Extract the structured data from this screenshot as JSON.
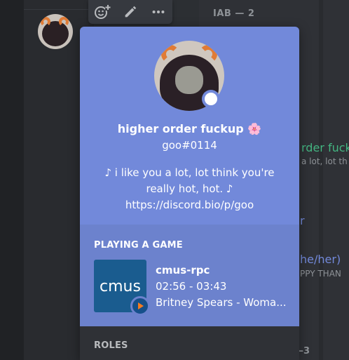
{
  "background": {
    "category_top": "IAB — 2",
    "category_bottom": "—3",
    "member_name_partial": "rder fuck",
    "member_sub_partial": "a lot, lot th",
    "member_r_partial": "r",
    "member_pronoun_partial": "he/her)",
    "member_sub2_partial": "PPY THAN"
  },
  "toolbar": {
    "add_reaction_icon": "add-reaction-icon",
    "edit_icon": "pencil-icon",
    "more_icon": "more-icon"
  },
  "profile": {
    "display_name": "higher order fuckup 🌸",
    "tag": "goo#0114",
    "bio_lines": [
      "♪ i like you a lot, lot think you're",
      "really hot, hot. ♪",
      "https://discord.bio/p/goo"
    ],
    "status": "online"
  },
  "activity": {
    "header": "PLAYING A GAME",
    "icon_text": "cmus",
    "name": "cmus-rpc",
    "time": "02:56 - 03:43",
    "details": "Britney Spears - Woma..."
  },
  "roles": {
    "header": "ROLES"
  },
  "colors": {
    "blurple": "#7289da",
    "online": "#ffffff",
    "game_bg": "#1a5c8f",
    "badge_orange": "#f57c1f"
  }
}
